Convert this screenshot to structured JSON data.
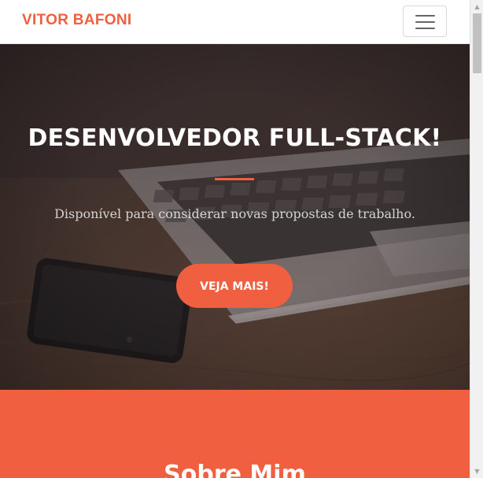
{
  "navbar": {
    "brand": "VITOR BAFONI",
    "toggle_icon": "hamburger-menu-icon"
  },
  "hero": {
    "title": "DESENVOLVEDOR FULL-STACK!",
    "subtitle": "Disponível para considerar novas propostas de trabalho.",
    "cta_label": "VEJA MAIS!"
  },
  "about": {
    "title": "Sobre Mim"
  },
  "colors": {
    "accent": "#f05f40",
    "hero_overlay": "#4a4140",
    "white": "#ffffff"
  }
}
